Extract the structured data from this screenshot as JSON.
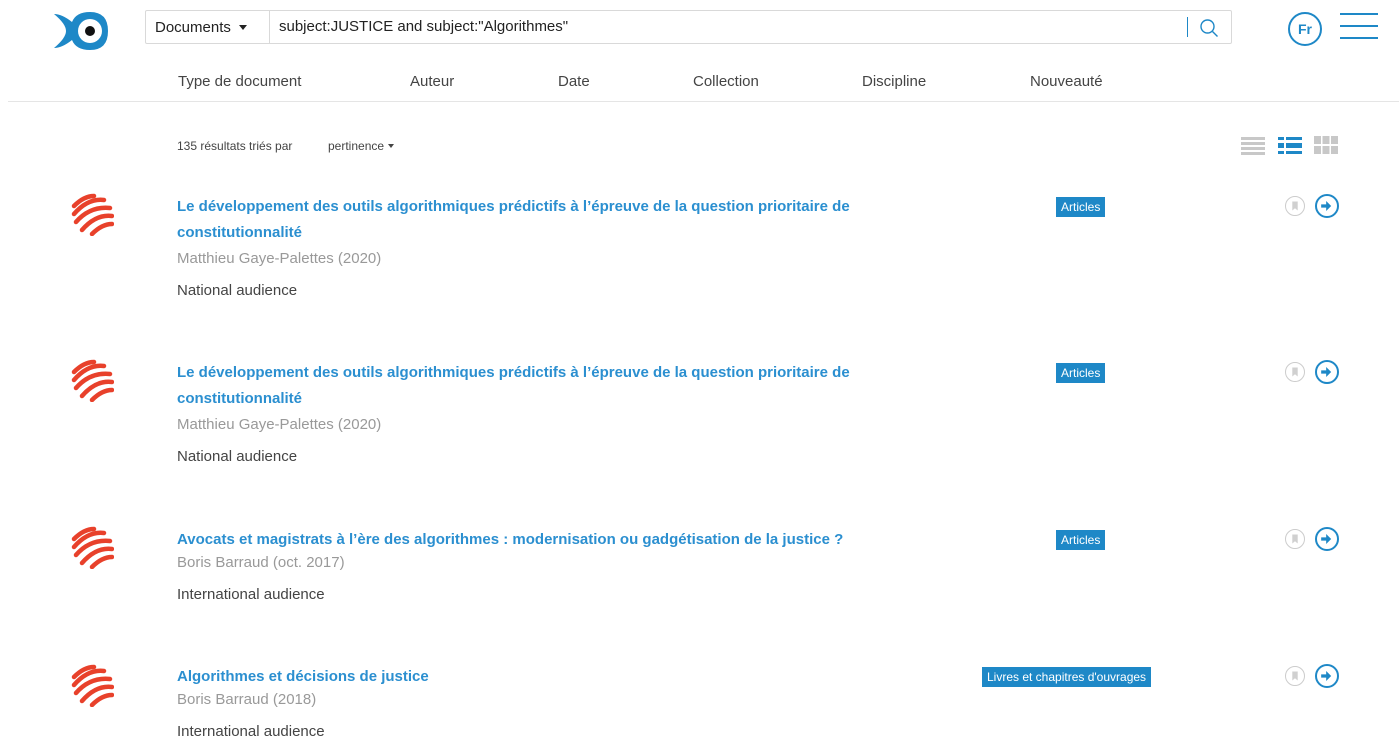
{
  "header": {
    "search_scope": "Documents",
    "query": "subject:JUSTICE and subject:\"Algorithmes\"",
    "lang": "Fr"
  },
  "facets": [
    {
      "label": "Type de document"
    },
    {
      "label": "Auteur"
    },
    {
      "label": "Date"
    },
    {
      "label": "Collection"
    },
    {
      "label": "Discipline"
    },
    {
      "label": "Nouveauté"
    }
  ],
  "results_info": {
    "count_text": "135 résultats triés par",
    "sort": "pertinence"
  },
  "results": [
    {
      "title": "Le développement des outils algorithmiques prédictifs à l’épreuve de la question prioritaire de constitutionnalité",
      "author": "Matthieu Gaye-Palettes (2020)",
      "audience": "National audience",
      "type": "Articles"
    },
    {
      "title": "Le développement des outils algorithmiques prédictifs à l’épreuve de la question prioritaire de constitutionnalité",
      "author": "Matthieu Gaye-Palettes (2020)",
      "audience": "National audience",
      "type": "Articles"
    },
    {
      "title": "Avocats et magistrats à l’ère des algorithmes : modernisation ou gadgétisation de la justice ?",
      "author": "Boris Barraud (oct. 2017)",
      "audience": "International audience",
      "type": "Articles"
    },
    {
      "title": "Algorithmes et décisions de justice",
      "author": "Boris Barraud (2018)",
      "audience": "International audience",
      "type": "Livres et chapitres d'ouvrages"
    }
  ],
  "colors": {
    "accent": "#1e88c7",
    "title": "#2b8fd0",
    "source_icon": "#e8412b",
    "logo": "#1e88c7"
  }
}
